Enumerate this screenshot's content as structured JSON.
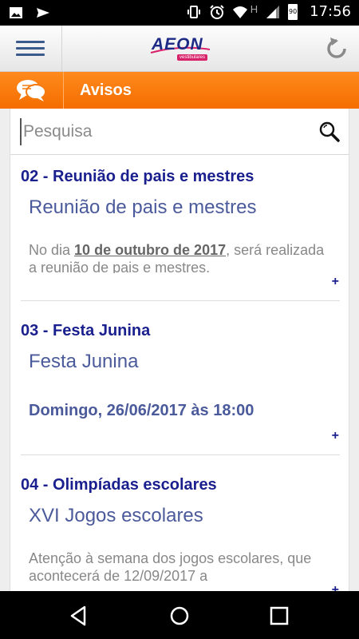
{
  "status_bar": {
    "time": "17:56",
    "battery_level": "90",
    "network_type": "H",
    "icons": [
      "image-icon",
      "send-icon",
      "vibrate-icon",
      "alarm-icon",
      "wifi-icon",
      "signal-icon",
      "battery-icon"
    ]
  },
  "app_bar": {
    "logo_text": "AEON",
    "logo_tagline": "vestibulares",
    "icons": [
      "menu-icon",
      "refresh-icon"
    ]
  },
  "section": {
    "title": "Avisos",
    "icon": "chat-icon"
  },
  "search": {
    "placeholder": "Pesquisa",
    "icon": "search-icon"
  },
  "notices": [
    {
      "title": "02 - Reunião de pais e mestres",
      "subtitle": "Reunião de pais e mestres",
      "body_prefix": "No dia ",
      "body_bold": "10 de outubro de 2017",
      "body_suffix": ", será realizada a reunião de pais e mestres.",
      "more": "+"
    },
    {
      "title": "03 - Festa Junina",
      "subtitle": "Festa Junina",
      "date": "Domingo, 26/06/2017 às 18:00",
      "more": "+"
    },
    {
      "title": "04 - Olimpíadas escolares",
      "subtitle": "XVI Jogos escolares",
      "body": "Atenção à semana dos jogos escolares, que acontecerá de 12/09/2017 a",
      "more": "+"
    }
  ],
  "nav_bar": {
    "icons": [
      "back-icon",
      "home-icon",
      "recents-icon"
    ]
  },
  "colors": {
    "accent_orange": "#f47b0f",
    "title_navy": "#1a1f8e",
    "subtitle_blue": "#4a5a9b"
  }
}
